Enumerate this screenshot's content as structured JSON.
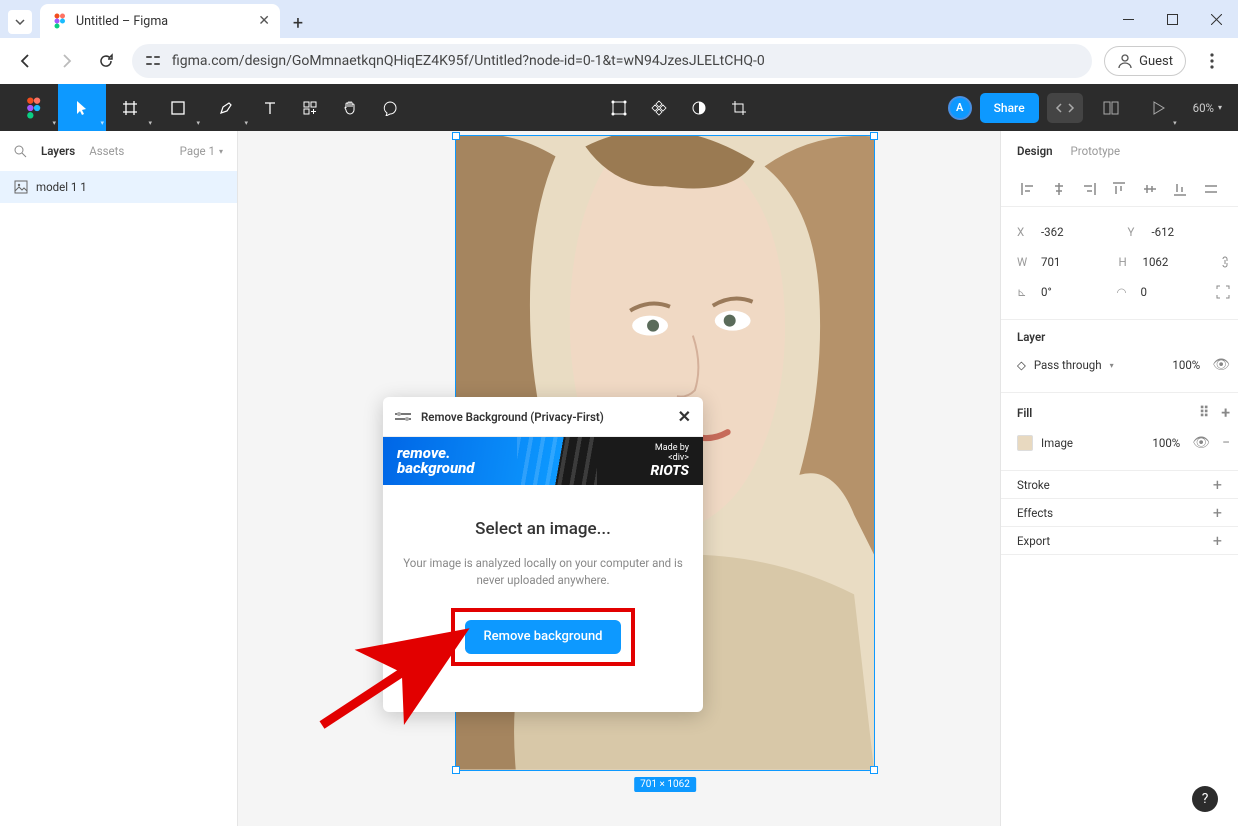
{
  "browser": {
    "tab_title": "Untitled – Figma",
    "url": "figma.com/design/GoMmnaetkqnQHiqEZ4K95f/Untitled?node-id=0-1&t=wN94JzesJLELtCHQ-0",
    "guest_label": "Guest"
  },
  "toolbar": {
    "avatar_initial": "A",
    "share_label": "Share",
    "zoom_label": "60%"
  },
  "left_panel": {
    "layers_tab": "Layers",
    "assets_tab": "Assets",
    "page_label": "Page 1",
    "layer_name": "model 1 1",
    "search_icon": "search"
  },
  "canvas": {
    "selection_dimensions": "701 × 1062"
  },
  "plugin": {
    "title": "Remove Background (Privacy-First)",
    "banner_line1": "remove.",
    "banner_line2": "background",
    "banner_madeby": "Made by",
    "banner_brand_tag": "<div>",
    "banner_brand": "RIOTS",
    "heading": "Select an image...",
    "subtext": "Your image is analyzed locally on your computer and is never uploaded anywhere.",
    "button_label": "Remove background"
  },
  "right_panel": {
    "design_tab": "Design",
    "prototype_tab": "Prototype",
    "x_label": "X",
    "x_value": "-362",
    "y_label": "Y",
    "y_value": "-612",
    "w_label": "W",
    "w_value": "701",
    "h_label": "H",
    "h_value": "1062",
    "rotation_label": "⟲",
    "rotation_value": "0°",
    "radius_label": "⌒",
    "radius_value": "0",
    "layer_section": "Layer",
    "blend_mode": "Pass through",
    "blend_opacity": "100%",
    "fill_section": "Fill",
    "fill_type": "Image",
    "fill_opacity": "100%",
    "stroke_section": "Stroke",
    "effects_section": "Effects",
    "export_section": "Export"
  },
  "help": {
    "label": "?"
  }
}
